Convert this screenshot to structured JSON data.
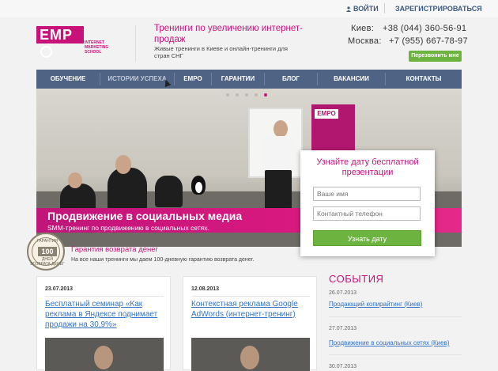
{
  "topbar": {
    "login_label": "ВОЙТИ",
    "register_label": "ЗАРЕГИСТРИРОВАТЬСЯ"
  },
  "header": {
    "logo_text": "EMP",
    "logo_subtitle": "INTERNET MARKETING SCHOOL",
    "title": "Тренинги по увеличению интернет-продаж",
    "subtitle": "Живые тренинги в Киеве и онлайн-тренинги для стран СНГ",
    "phones": [
      {
        "city": "Киев:",
        "number": "+38 (044) 360-56-91"
      },
      {
        "city": "Москва:",
        "number": "+7 (955) 667-78-97"
      }
    ],
    "callback_label": "Перезвонить мне"
  },
  "nav": {
    "items": [
      {
        "label": "ОБУЧЕНИЕ"
      },
      {
        "label": "ИСТОРИИ УСПЕХА"
      },
      {
        "label": "EMPO"
      },
      {
        "label": "ГАРАНТИИ"
      },
      {
        "label": "БЛОГ"
      },
      {
        "label": "ВАКАНСИИ"
      },
      {
        "label": "КОНТАКТЫ"
      }
    ]
  },
  "hero": {
    "slide_count": 5,
    "active_slide": 4,
    "banner_logo": "EMPO",
    "title": "Продвижение в социальных медиа",
    "subtitle": "SMM-тренинг по продвижению в социальных сетях."
  },
  "form": {
    "title": "Узнайте дату бесплатной презентации",
    "name_placeholder": "Ваше имя",
    "phone_placeholder": "Контактный телефон",
    "submit_label": "Узнать дату"
  },
  "guarantee": {
    "badge_top": "ГАРАНТИЯ",
    "badge_number": "100",
    "badge_unit": "ДНЕЙ",
    "badge_bottom": "ВОЗВРАТА ДЕНЕГ",
    "title": "Гарантия возврата денег",
    "text": "На все наши тренинги мы даем 100-дневную гарантию возврата денег."
  },
  "cards": [
    {
      "date": "23.07.2013",
      "title": "Бесплатный семинар «Как реклама в Яндексе поднимает продажи на 30,9%»"
    },
    {
      "date": "12.08.2013",
      "title": "Контекстная реклама Google AdWords (интернет-тренинг)"
    }
  ],
  "events": {
    "title": "СОБЫТИЯ",
    "items": [
      {
        "date": "26.07.2013",
        "title": "Продающий копирайтинг (Киев)"
      },
      {
        "date": "27.07.2013",
        "title": "Продвижение в социальных сетях (Киев)"
      },
      {
        "date": "30.07.2013",
        "title": ""
      }
    ]
  },
  "colors": {
    "brand": "#c8127a",
    "nav": "#4f6384",
    "accent_green": "#6db33f",
    "link": "#3473c4"
  }
}
